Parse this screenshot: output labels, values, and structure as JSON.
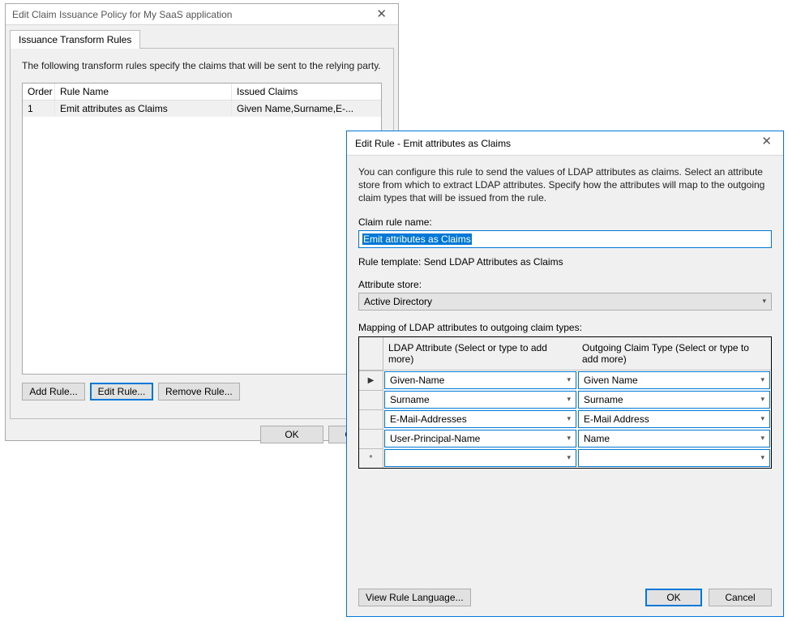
{
  "back": {
    "title": "Edit Claim Issuance Policy for My SaaS application",
    "tab": "Issuance Transform Rules",
    "intro": "The following transform rules specify the claims that will be sent to the relying party.",
    "headers": {
      "order": "Order",
      "name": "Rule Name",
      "issued": "Issued Claims"
    },
    "rows": [
      {
        "order": "1",
        "name": "Emit attributes as Claims",
        "issued": "Given Name,Surname,E-..."
      }
    ],
    "buttons": {
      "add": "Add Rule...",
      "edit": "Edit Rule...",
      "remove": "Remove Rule..."
    },
    "ok": "OK",
    "cancel": "Cancel"
  },
  "front": {
    "title": "Edit Rule - Emit attributes as Claims",
    "desc": "You can configure this rule to send the values of LDAP attributes as claims. Select an attribute store from which to extract LDAP attributes. Specify how the attributes will map to the outgoing claim types that will be issued from the rule.",
    "claim_rule_name_label": "Claim rule name:",
    "claim_rule_name_value": "Emit attributes as Claims",
    "rule_template": "Rule template: Send LDAP Attributes as Claims",
    "attr_store_label": "Attribute store:",
    "attr_store_value": "Active Directory",
    "mapping_label": "Mapping of LDAP attributes to outgoing claim types:",
    "col_ldap": "LDAP Attribute (Select or type to add more)",
    "col_out": "Outgoing Claim Type (Select or type to add more)",
    "rows": [
      {
        "ldap": "Given-Name",
        "out": "Given Name"
      },
      {
        "ldap": "Surname",
        "out": "Surname"
      },
      {
        "ldap": "E-Mail-Addresses",
        "out": "E-Mail Address"
      },
      {
        "ldap": "User-Principal-Name",
        "out": "Name"
      },
      {
        "ldap": "",
        "out": ""
      }
    ],
    "view_lang": "View Rule Language...",
    "ok": "OK",
    "cancel": "Cancel"
  }
}
